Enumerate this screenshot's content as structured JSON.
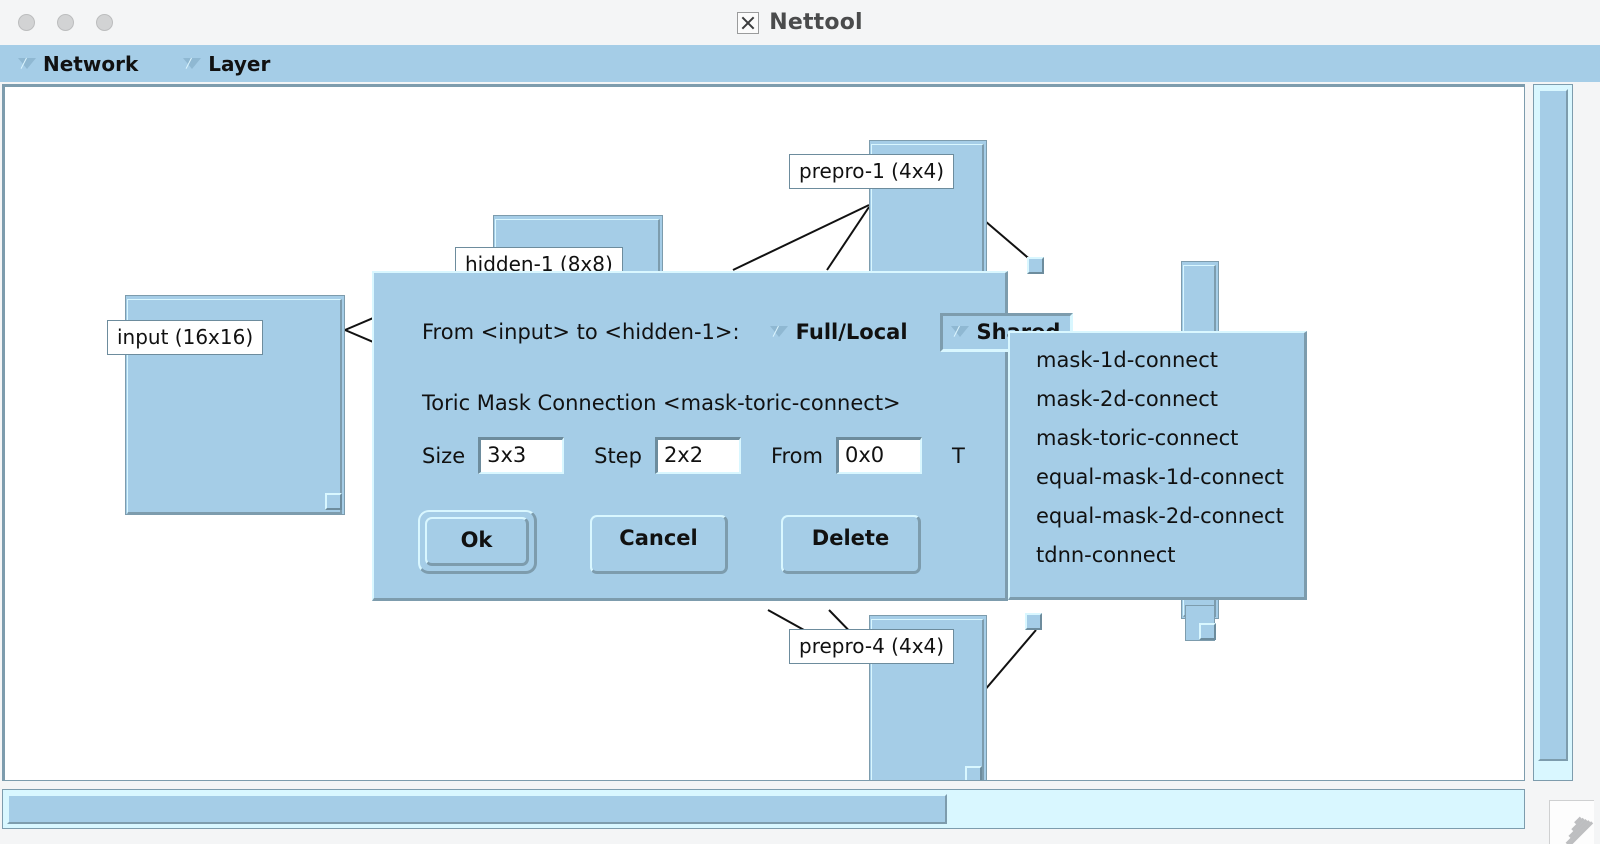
{
  "window": {
    "title": "Nettool",
    "app_icon": "x-icon",
    "dots": [
      "window-dot-1",
      "window-dot-2",
      "window-dot-3"
    ]
  },
  "menubar": {
    "items": [
      {
        "label": "Network",
        "icon": "chevron-down-icon"
      },
      {
        "label": "Layer",
        "icon": "chevron-down-icon"
      }
    ]
  },
  "canvas": {
    "nodes": [
      {
        "id": "input",
        "label": "input (16x16)"
      },
      {
        "id": "hidden-1",
        "label": "hidden-1 (8x8)"
      },
      {
        "id": "prepro-1",
        "label": "prepro-1 (4x4)"
      },
      {
        "id": "prepro-4",
        "label": "prepro-4 (4x4)"
      }
    ]
  },
  "dialog": {
    "connection_text": "From <input> to <hidden-1>:",
    "full_local": {
      "label": "Full/Local",
      "icon": "chevron-down-icon"
    },
    "shared": {
      "label": "Shared",
      "icon": "chevron-down-icon",
      "state": "pressed"
    },
    "description": "Toric Mask Connection <mask-toric-connect>",
    "fields": [
      {
        "label": "Size",
        "value": "3x3"
      },
      {
        "label": "Step",
        "value": "2x2"
      },
      {
        "label": "From",
        "value": "0x0"
      }
    ],
    "truncated_label": "T",
    "buttons": [
      {
        "label": "Ok",
        "default": true
      },
      {
        "label": "Cancel",
        "default": false
      },
      {
        "label": "Delete",
        "default": false
      }
    ]
  },
  "popup_menu": {
    "items": [
      "mask-1d-connect",
      "mask-2d-connect",
      "mask-toric-connect",
      "equal-mask-1d-connect",
      "equal-mask-2d-connect",
      "tdnn-connect"
    ]
  },
  "scrollbars": {
    "vertical": "vertical-scrollbar",
    "horizontal": "horizontal-scrollbar"
  },
  "colors": {
    "panel": "#a5cde7",
    "highlight": "#d9f7ff",
    "shadow": "#7d9cad",
    "titlebar": "#f4f5f6",
    "canvas": "#ffffff",
    "text": "#111111"
  }
}
